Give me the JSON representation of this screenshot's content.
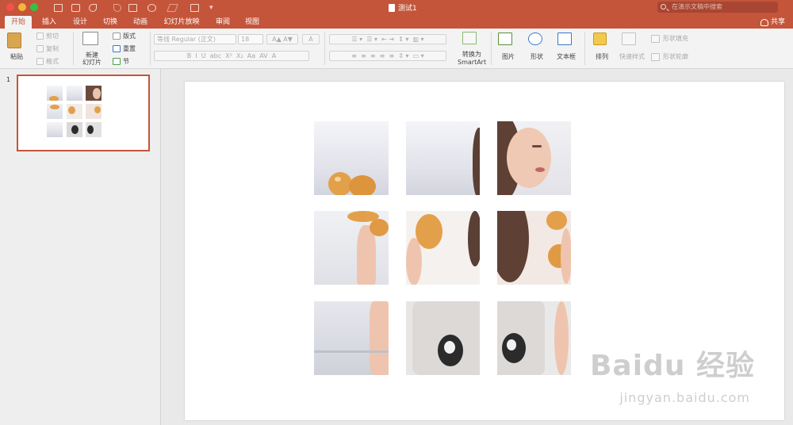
{
  "titlebar": {
    "doc_title": "测试1",
    "search_placeholder": "在演示文稿中搜索"
  },
  "tabs": [
    "开始",
    "插入",
    "设计",
    "切换",
    "动画",
    "幻灯片放映",
    "审阅",
    "视图"
  ],
  "share_label": "共享",
  "ribbon": {
    "paste": "粘贴",
    "cut": "剪切",
    "copy": "复制",
    "format": "格式",
    "new_slide": "新建\n幻灯片",
    "layout": "版式",
    "reset": "重置",
    "section": "节",
    "font_name": "等线 Regular (正文)",
    "font_size": "18",
    "convert_smartart_1": "转换为",
    "convert_smartart_2": "SmartArt",
    "picture": "图片",
    "shapes": "形状",
    "textbox": "文本框",
    "arrange": "排列",
    "quick_styles": "快速样式",
    "shape_fill": "形状填充",
    "shape_outline": "形状轮廓"
  },
  "thumbnail": {
    "slide_number": "1"
  },
  "watermark": {
    "brand": "Baidu 经验",
    "url": "jingyan.baidu.com"
  },
  "colors": {
    "accent": "#c4553a"
  }
}
